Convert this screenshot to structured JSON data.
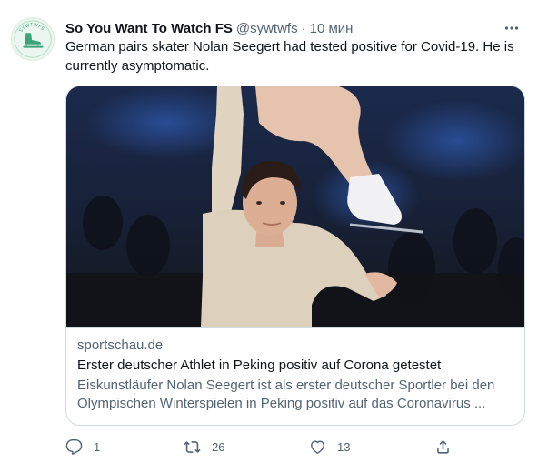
{
  "tweet": {
    "author_name": "So You Want To Watch FS",
    "handle": "@sywtwfs",
    "separator": "·",
    "time": "10 мин",
    "text": "German pairs skater Nolan Seegert had tested positive for Covid-19. He is currently asymptomatic.",
    "avatar_icon": "figure-skate-logo",
    "avatar_text": "SYWTWFS",
    "more_icon": "more-icon"
  },
  "card": {
    "domain": "sportschau.de",
    "title": "Erster deutscher Athlet in Peking positiv auf Corona getestet",
    "description": "Eiskunstläufer Nolan Seegert ist als erster deutscher Sportler bei den Olympischen Winterspielen in Peking positiv auf das Coronavirus ..."
  },
  "actions": {
    "reply": {
      "icon": "reply-icon",
      "count": "1"
    },
    "retweet": {
      "icon": "retweet-icon",
      "count": "26"
    },
    "like": {
      "icon": "heart-icon",
      "count": "13"
    },
    "share": {
      "icon": "share-icon"
    }
  },
  "colors": {
    "text_primary": "#0f1419",
    "text_secondary": "#536471",
    "border": "#cfd9de",
    "avatar_accent": "#3aa37a"
  }
}
